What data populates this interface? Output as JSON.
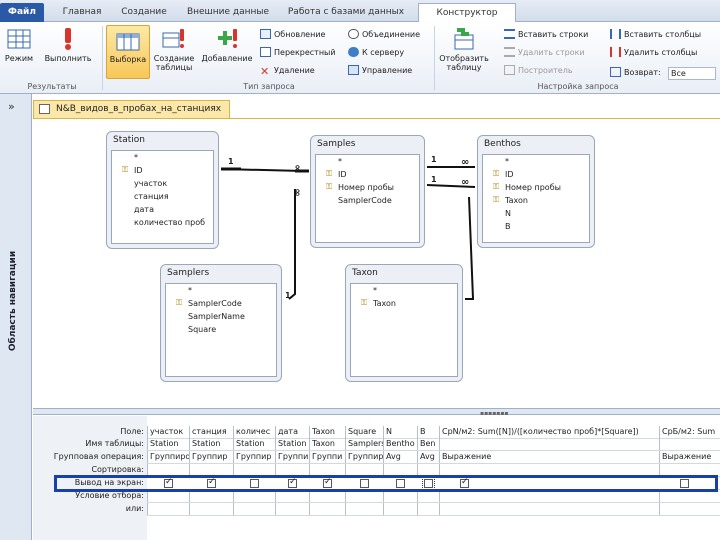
{
  "tabs": {
    "file": "Файл",
    "home": "Главная",
    "create": "Создание",
    "external": "Внешние данные",
    "dbtools": "Работа с базами данных",
    "design": "Конструктор"
  },
  "ribbon": {
    "results": {
      "label": "Результаты",
      "view": "Режим",
      "run": "Выполнить"
    },
    "querytype": {
      "label": "Тип запроса",
      "select": "Выборка",
      "maketable": "Создание таблицы",
      "append": "Добавление",
      "update": "Обновление",
      "crosstab": "Перекрестный",
      "delete": "Удаление",
      "union": "Объединение",
      "passthrough": "К серверу",
      "ddl": "Управление"
    },
    "setup": {
      "label": "Настройка запроса",
      "showtable": "Отобразить таблицу",
      "insert_rows": "Вставить строки",
      "delete_rows": "Удалить строки",
      "builder": "Построитель",
      "insert_cols": "Вставить столбцы",
      "delete_cols": "Удалить столбцы",
      "return": "Возврат:",
      "return_value": "Все"
    }
  },
  "nav": {
    "toggle": "»",
    "label": "Область навигации"
  },
  "doc": {
    "tab_title": "N&B_видов_в_пробах_на_станциях"
  },
  "tables": {
    "station": {
      "title": "Station",
      "fields": [
        "*",
        "ID",
        "участок",
        "станция",
        "дата",
        "количество проб"
      ]
    },
    "samples": {
      "title": "Samples",
      "fields": [
        "*",
        "ID",
        "Номер пробы",
        "SamplerCode"
      ]
    },
    "benthos": {
      "title": "Benthos",
      "fields": [
        "*",
        "ID",
        "Номер пробы",
        "Taxon",
        "N",
        "B"
      ]
    },
    "samplers": {
      "title": "Samplers",
      "fields": [
        "*",
        "SamplerCode",
        "SamplerName",
        "Square"
      ]
    },
    "taxon": {
      "title": "Taxon",
      "fields": [
        "*",
        "Taxon"
      ]
    }
  },
  "relations": {
    "one": "1",
    "many": "∞"
  },
  "grid": {
    "row_labels": [
      "Поле:",
      "Имя таблицы:",
      "Групповая операция:",
      "Сортировка:",
      "Вывод на экран:",
      "Условие отбора:",
      "или:"
    ],
    "columns": [
      {
        "field": "участок",
        "table": "Station",
        "total": "Группиро",
        "show": true
      },
      {
        "field": "станция",
        "table": "Station",
        "total": "Группир",
        "show": true
      },
      {
        "field": "количес",
        "table": "Station",
        "total": "Группир",
        "show": false
      },
      {
        "field": "дата",
        "table": "Station",
        "total": "Группи",
        "show": true
      },
      {
        "field": "Taxon",
        "table": "Taxon",
        "total": "Группи",
        "show": true
      },
      {
        "field": "Square",
        "table": "Samplers",
        "total": "Группир",
        "show": false
      },
      {
        "field": "N",
        "table": "Bentho",
        "total": "Avg",
        "show": false
      },
      {
        "field": "B",
        "table": "Ben",
        "total": "Avg",
        "show": false
      },
      {
        "field": "СрN/м2: Sum([N])/([количество проб]*[Square])",
        "table": "",
        "total": "Выражение",
        "show": true
      },
      {
        "field": "СрБ/м2: Sum",
        "table": "",
        "total": "Выражение",
        "show": false
      }
    ]
  }
}
